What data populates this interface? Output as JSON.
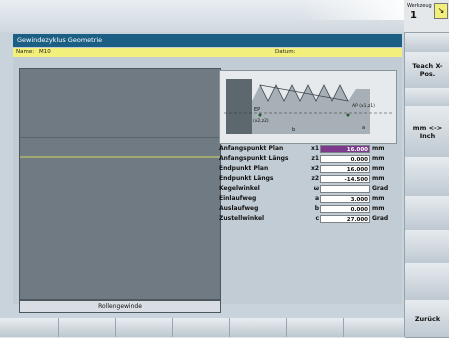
{
  "window": {
    "title": "Gewindezyklus Geometrie"
  },
  "header": {
    "name_label": "Name:",
    "name_value": "M10",
    "date_label": "Datum:"
  },
  "graphic": {
    "caption": "Rollengewinde"
  },
  "help_image": {
    "labels": {
      "ep": "EP",
      "ep_coord": "(x2,z2)",
      "ap": "AP (x1,z1)",
      "b": "b",
      "a": "a"
    }
  },
  "params": [
    {
      "label": "Anfangspunkt Plan",
      "symbol": "x1",
      "value": "16.000",
      "unit": "mm",
      "active": true
    },
    {
      "label": "Anfangspunkt Längs",
      "symbol": "z1",
      "value": "0.000",
      "unit": "mm",
      "active": false
    },
    {
      "label": "Endpunkt Plan",
      "symbol": "x2",
      "value": "16.000",
      "unit": "mm",
      "active": false
    },
    {
      "label": "Endpunkt Längs",
      "symbol": "z2",
      "value": "-14.500",
      "unit": "mm",
      "active": false
    },
    {
      "label": "Kegelwinkel",
      "symbol": "ω",
      "value": "",
      "unit": "Grad",
      "active": false
    },
    {
      "label": "Einlaufweg",
      "symbol": "a",
      "value": "3.000",
      "unit": "mm",
      "active": false
    },
    {
      "label": "Auslaufweg",
      "symbol": "b",
      "value": "0.000",
      "unit": "mm",
      "active": false
    },
    {
      "label": "Zustellwinkel",
      "symbol": "c",
      "value": "27.000",
      "unit": "Grad",
      "active": false
    }
  ],
  "tool": {
    "label": "Werkzeug",
    "number": "1"
  },
  "softkeys_right": [
    {
      "label": ""
    },
    {
      "label": "Teach X-Pos."
    },
    {
      "label": ""
    },
    {
      "label": "mm <-> Inch"
    },
    {
      "label": ""
    },
    {
      "label": ""
    },
    {
      "label": ""
    },
    {
      "label": ""
    },
    {
      "label": "Zurück"
    }
  ],
  "colors": {
    "title_bar": "#1c5f84",
    "name_bar": "#f2f07a",
    "active_field": "#7d3a8c"
  }
}
